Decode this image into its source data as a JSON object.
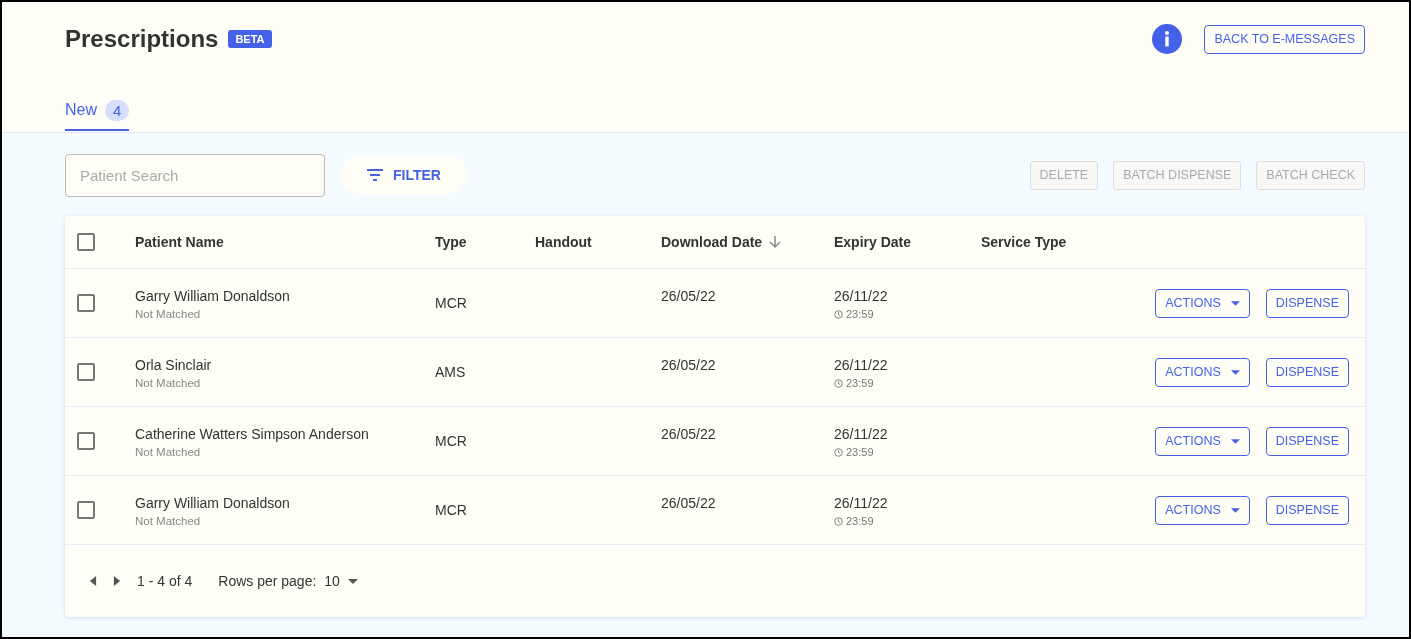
{
  "page": {
    "title": "Prescriptions",
    "badge": "BETA",
    "back_button": "BACK TO E-MESSAGES"
  },
  "tabs": [
    {
      "label": "New",
      "count": "4",
      "selected": true
    }
  ],
  "toolbar": {
    "search": {
      "placeholder": "Patient Search"
    },
    "filter_button": "FILTER",
    "actions": [
      {
        "label": "DELETE",
        "disabled": true
      },
      {
        "label": "BATCH DISPENSE",
        "disabled": true
      },
      {
        "label": "BATCH CHECK",
        "disabled": true
      }
    ]
  },
  "table": {
    "select_all": {
      "checked": false
    },
    "columns": [
      {
        "label": "Patient Name",
        "sorted": false
      },
      {
        "label": "Type",
        "sorted": false
      },
      {
        "label": "Handout",
        "sorted": false
      },
      {
        "label": "Download Date",
        "sorted": true
      },
      {
        "label": "Expiry Date",
        "sorted": false
      },
      {
        "label": "Service Type",
        "sorted": false
      }
    ],
    "rows": [
      {
        "checked": false,
        "patient_name": "Garry William Donaldson",
        "match_status": "Not Matched",
        "type": "MCR",
        "download_date": "26/05/22",
        "expiry_date": "26/11/22",
        "expiry_time": "23:59",
        "actions_button": "ACTIONS",
        "dispense_button": "DISPENSE"
      },
      {
        "checked": false,
        "patient_name": "Orla Sinclair",
        "match_status": "Not Matched",
        "type": "AMS",
        "download_date": "26/05/22",
        "expiry_date": "26/11/22",
        "expiry_time": "23:59",
        "actions_button": "ACTIONS",
        "dispense_button": "DISPENSE"
      },
      {
        "checked": false,
        "patient_name": "Catherine Watters Simpson Anderson",
        "match_status": "Not Matched",
        "type": "MCR",
        "download_date": "26/05/22",
        "expiry_date": "26/11/22",
        "expiry_time": "23:59",
        "actions_button": "ACTIONS",
        "dispense_button": "DISPENSE"
      },
      {
        "checked": false,
        "patient_name": "Garry William Donaldson",
        "match_status": "Not Matched",
        "type": "MCR",
        "download_date": "26/05/22",
        "expiry_date": "26/11/22",
        "expiry_time": "23:59",
        "actions_button": "ACTIONS",
        "dispense_button": "DISPENSE"
      }
    ],
    "pagination": {
      "range": "1 - 4 of 4",
      "rows_per_page_label": "Rows per page:",
      "rows_per_page": "10"
    }
  }
}
